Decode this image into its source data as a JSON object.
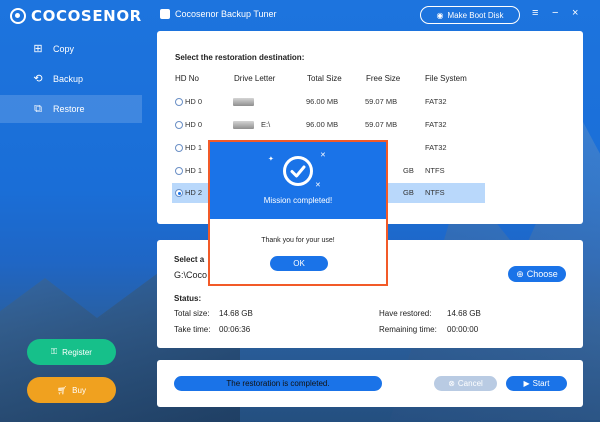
{
  "app": {
    "brand": "COCOSENOR",
    "title": "Cocosenor Backup Tuner",
    "boot_label": "Make Boot Disk",
    "win_menu": "≡",
    "win_min": "−",
    "win_close": "×"
  },
  "sidebar": {
    "items": [
      {
        "label": "Copy",
        "icon": "copy-icon"
      },
      {
        "label": "Backup",
        "icon": "backup-icon"
      },
      {
        "label": "Restore",
        "icon": "restore-icon"
      }
    ],
    "register_label": "Register",
    "buy_label": "Buy"
  },
  "destination": {
    "title": "Select the restoration destination:",
    "columns": [
      "HD No",
      "Drive Letter",
      "Total Size",
      "Free Size",
      "File System"
    ],
    "rows": [
      {
        "hd": "HD 0",
        "letter": "",
        "total": "96.00 MB",
        "free": "59.07 MB",
        "fs": "FAT32",
        "selected": false
      },
      {
        "hd": "HD 0",
        "letter": "E:\\",
        "total": "96.00 MB",
        "free": "59.07 MB",
        "fs": "FAT32",
        "selected": false
      },
      {
        "hd": "HD 1",
        "letter": "",
        "total": "",
        "free": "",
        "fs": "FAT32",
        "selected": false
      },
      {
        "hd": "HD 1",
        "letter": "",
        "total": "",
        "free": "GB",
        "fs": "NTFS",
        "selected": false
      },
      {
        "hd": "HD 2",
        "letter": "",
        "total": "",
        "free": "GB",
        "fs": "NTFS",
        "selected": true
      }
    ]
  },
  "image_section": {
    "label": "Select a",
    "path": "G:\\Coco",
    "choose_label": "Choose",
    "status_label": "Status:",
    "total_size_label": "Total size:",
    "total_size": "14.68 GB",
    "take_time_label": "Take time:",
    "take_time": "00:06:36",
    "restored_label": "Have restored:",
    "restored": "14.68 GB",
    "remaining_label": "Remaining time:",
    "remaining": "00:00:00"
  },
  "footer": {
    "progress_text": "The restoration is completed.",
    "progress_fraction": 1.0,
    "cancel_label": "Cancel",
    "start_label": "Start"
  },
  "dialog": {
    "title": "Mission completed!",
    "message": "Thank you for your use!",
    "ok_label": "OK"
  },
  "colors": {
    "accent": "#1a73e8",
    "register": "#16c08a",
    "buy": "#f0a11f",
    "dialog_border": "#f25a28",
    "selected_row": "#b9d8fb"
  }
}
